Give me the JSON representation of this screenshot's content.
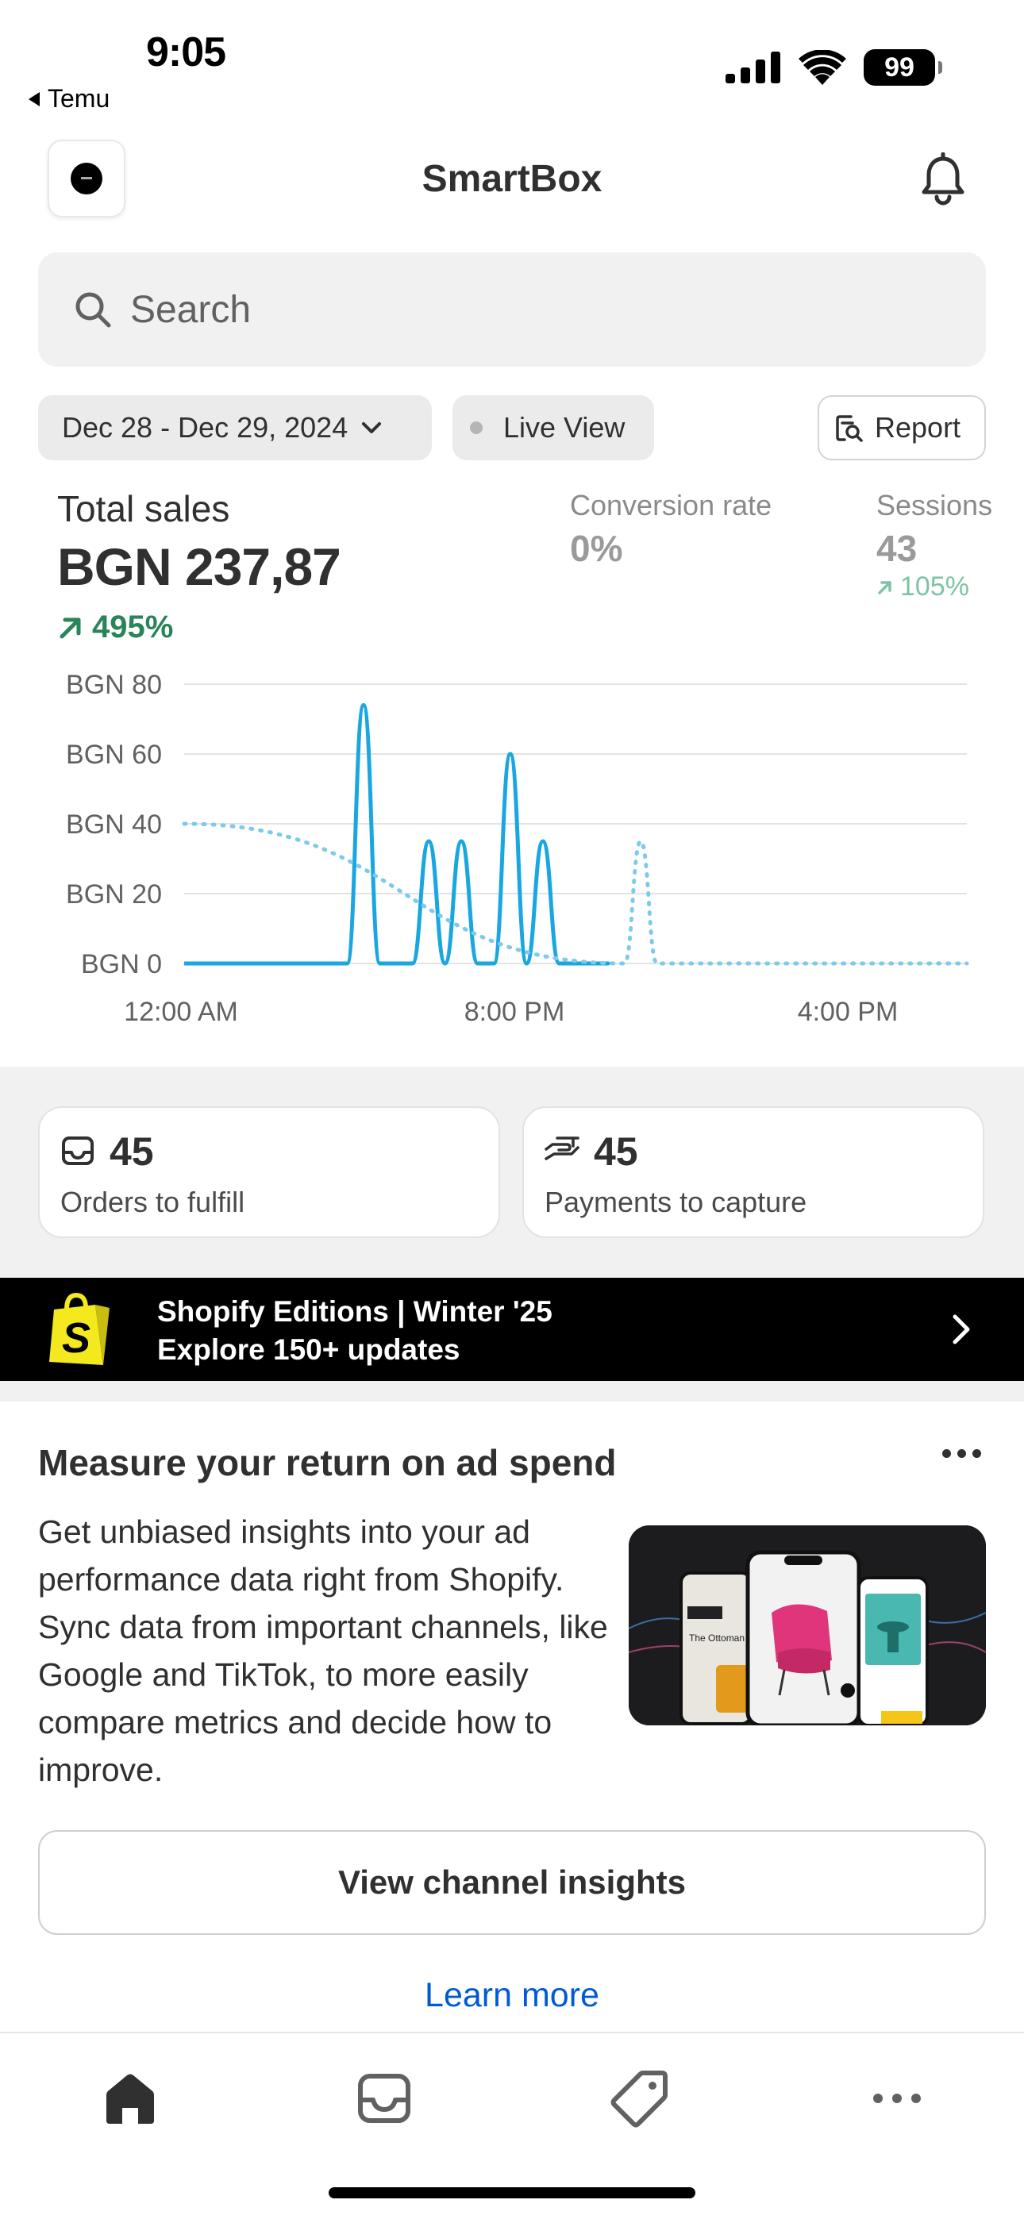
{
  "status_bar": {
    "time": "9:05",
    "back_app": "Temu",
    "battery": "99"
  },
  "header": {
    "title": "SmartBox"
  },
  "search": {
    "placeholder": "Search"
  },
  "filters": {
    "date_range": "Dec 28 - Dec 29, 2024",
    "live_view": "Live View",
    "report": "Report"
  },
  "metrics": {
    "total_sales": {
      "label": "Total sales",
      "value": "BGN 237,87",
      "change": "495%"
    },
    "conversion_rate": {
      "label": "Conversion rate",
      "value": "0%"
    },
    "sessions": {
      "label": "Sessions",
      "value": "43",
      "change": "105%"
    }
  },
  "chart_data": {
    "type": "line",
    "y_ticks": [
      "BGN 80",
      "BGN 60",
      "BGN 40",
      "BGN 20",
      "BGN 0"
    ],
    "ylim": [
      0,
      80
    ],
    "x_ticks": [
      "12:00 AM",
      "8:00 PM",
      "4:00 PM"
    ],
    "colors": {
      "current": "#19a6e1",
      "previous": "#7ccbea",
      "grid": "#e3e3e3"
    },
    "series": [
      {
        "style": "solid",
        "x": [
          0,
          8,
          9,
          10,
          11,
          12,
          13,
          14,
          15,
          16,
          17,
          18,
          19,
          20,
          21,
          22,
          23,
          24,
          25,
          26
        ],
        "values": [
          0,
          0,
          0,
          0,
          74,
          0,
          0,
          0,
          35,
          0,
          35,
          0,
          0,
          60,
          0,
          35,
          0,
          0,
          0,
          0
        ],
        "x_end": 24
      },
      {
        "style": "dotted",
        "x": [
          0,
          27,
          28,
          29
        ],
        "values": [
          40,
          0,
          35,
          0
        ],
        "x_end": 48
      }
    ],
    "x_start": 0,
    "x_total": 48,
    "grid": true
  },
  "cards": {
    "orders": {
      "count": "45",
      "label": "Orders to fulfill"
    },
    "payments": {
      "count": "45",
      "label": "Payments to capture"
    }
  },
  "banner": {
    "line1": "Shopify Editions | Winter '25",
    "line2": "Explore 150+ updates"
  },
  "promo": {
    "title": "Measure your return on ad spend",
    "body": "Get unbiased insights into your ad performance data right from Shopify. Sync data from important channels, like Google and TikTok, to more easily compare metrics and decide how to improve.",
    "image_text": "The Ottoman Event",
    "cta": "View channel insights",
    "link": "Learn more"
  },
  "tabbar": {
    "items": [
      "home-icon",
      "inbox-icon",
      "tag-icon",
      "more-icon"
    ]
  }
}
